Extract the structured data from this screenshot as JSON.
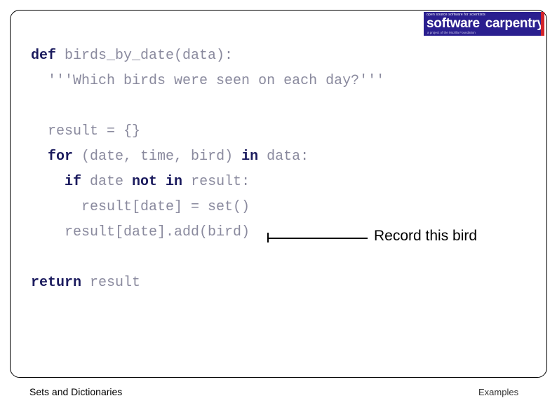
{
  "slide": {
    "logo": {
      "tagline_top": "open source software for scientists",
      "word_one": "software",
      "word_two": "carpentry",
      "tagline_bottom": "a project of the Mozilla Foundation"
    },
    "code_lines": [
      {
        "indent": 0,
        "segments": [
          {
            "text": "def ",
            "style": "kw"
          },
          {
            "text": "birds_by_date(data):",
            "style": "plain"
          }
        ]
      },
      {
        "indent": 1,
        "segments": [
          {
            "text": "'''Which birds were seen on each day?'''",
            "style": "plain"
          }
        ]
      },
      {
        "indent": 0,
        "segments": [
          {
            "text": "",
            "style": "plain"
          }
        ]
      },
      {
        "indent": 1,
        "segments": [
          {
            "text": "result = {}",
            "style": "plain"
          }
        ]
      },
      {
        "indent": 1,
        "segments": [
          {
            "text": "for ",
            "style": "kw"
          },
          {
            "text": "(date, time, bird) ",
            "style": "plain"
          },
          {
            "text": "in ",
            "style": "kw"
          },
          {
            "text": "data:",
            "style": "plain"
          }
        ]
      },
      {
        "indent": 2,
        "segments": [
          {
            "text": "if ",
            "style": "kw"
          },
          {
            "text": "date ",
            "style": "plain"
          },
          {
            "text": "not in ",
            "style": "kw"
          },
          {
            "text": "result:",
            "style": "plain"
          }
        ]
      },
      {
        "indent": 3,
        "segments": [
          {
            "text": "result[date] = set()",
            "style": "plain"
          }
        ]
      },
      {
        "indent": 2,
        "segments": [
          {
            "text": "result[date].add(bird)",
            "style": "plain"
          }
        ]
      },
      {
        "indent": 0,
        "segments": [
          {
            "text": "",
            "style": "plain"
          }
        ]
      },
      {
        "indent": 0,
        "segments": [
          {
            "text": "return ",
            "style": "kw"
          },
          {
            "text": "result",
            "style": "plain"
          }
        ]
      }
    ],
    "callout": {
      "label": "Record this bird"
    },
    "footer": {
      "left": "Sets and Dictionaries",
      "right": "Examples"
    },
    "colors": {
      "logo_background": "#2a1f8f",
      "logo_accent": "#d2232a",
      "code_plain": "#8a8a9e",
      "code_keyword": "#1b1b5e",
      "frame_border": "#000000"
    }
  }
}
